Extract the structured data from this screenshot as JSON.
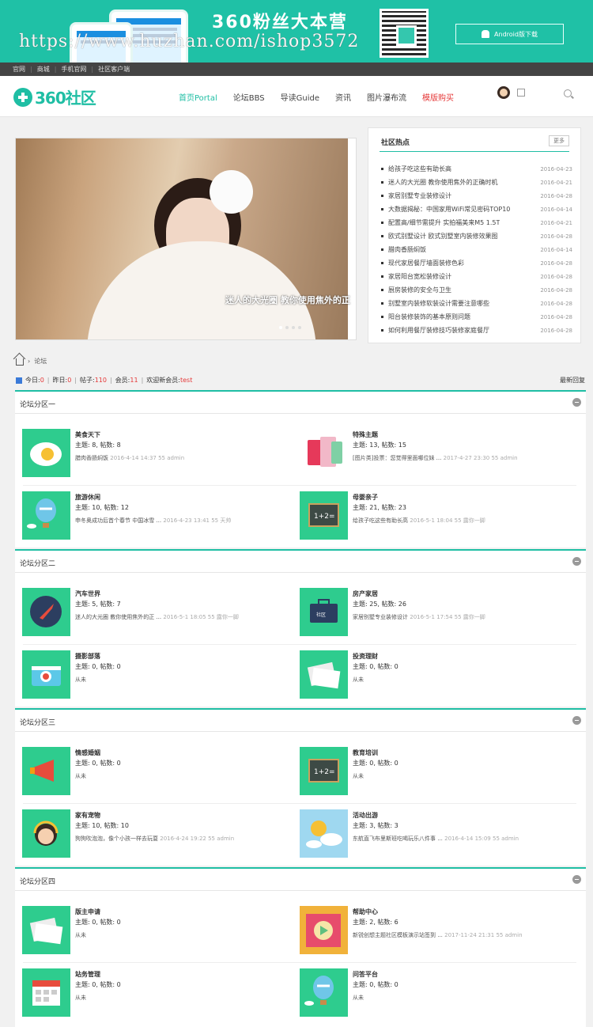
{
  "banner": {
    "title": "360粉丝大本营",
    "download": "Android版下载",
    "watermark": "https://www.huzhan.com/ishop3572",
    "phone_label": "360社区"
  },
  "topbar": {
    "links": [
      "官网",
      "商城",
      "手机官网",
      "社区客户端"
    ]
  },
  "header": {
    "logo": "360社区",
    "nav": [
      "首页Portal",
      "论坛BBS",
      "导读Guide",
      "资讯",
      "图片瀑布流",
      "模版购买"
    ]
  },
  "slider": {
    "caption": "迷人的大光圈 教你使用焦外的正"
  },
  "hot": {
    "title": "社区热点",
    "more": "更多",
    "items": [
      {
        "t": "给孩子吃这些有助长高",
        "d": "2016-04-23"
      },
      {
        "t": "迷人的大光圈 教你使用焦外的正确时机",
        "d": "2016-04-21"
      },
      {
        "t": "家居别墅专业装修设计",
        "d": "2016-04-28"
      },
      {
        "t": "大数据揭秘：中国家用WiFi常见密码TOP10",
        "d": "2016-04-14"
      },
      {
        "t": "配置高/细节需提升 实拍福美来M5 1.5T",
        "d": "2016-04-21"
      },
      {
        "t": "欧式别墅设计 欧式别墅室内装修效果图",
        "d": "2016-04-28"
      },
      {
        "t": "腊肉香肠焖饭",
        "d": "2016-04-14"
      },
      {
        "t": "现代家居餐厅墙面装修色彩",
        "d": "2016-04-28"
      },
      {
        "t": "家居阳台宽松装修设计",
        "d": "2016-04-28"
      },
      {
        "t": "厨房装修的安全与卫生",
        "d": "2016-04-28"
      },
      {
        "t": "别墅室内装修软装设计需要注意哪些",
        "d": "2016-04-28"
      },
      {
        "t": "阳台装修装饰的基本原则问题",
        "d": "2016-04-28"
      },
      {
        "t": "如何利用餐厅装修技巧装修家庭餐厅",
        "d": "2016-04-28"
      }
    ]
  },
  "crumb": {
    "label": "论坛"
  },
  "stats": {
    "today_l": "今日:",
    "today": "0",
    "yest_l": "昨日:",
    "yest": "0",
    "posts_l": "帖子:",
    "posts": "110",
    "members_l": "会员:",
    "members": "11",
    "welcome_l": "欢迎新会员:",
    "welcome": "test",
    "latest": "最新回复"
  },
  "sections": [
    {
      "title": "论坛分区一",
      "forums": [
        {
          "name": "美食天下",
          "count": "主题: 8, 帖数: 8",
          "last": "腊肉香肠焖饭",
          "meta": "2016-4-14 14:37 55 admin",
          "icon": "egg-icon"
        },
        {
          "name": "特殊主题",
          "count": "主题: 13, 帖数: 15",
          "last": "[图片类]投票：您觉得里面哪位妹 ...",
          "meta": "2017-4-27 23:30 55 admin",
          "icon": "phones-icon"
        },
        {
          "name": "旅游休闲",
          "count": "主题: 10, 帖数: 12",
          "last": "申冬奥成功后首个春节 中国冰雪 ...",
          "meta": "2016-4-23 13:41 55 天帅",
          "icon": "balloon-icon"
        },
        {
          "name": "母婴亲子",
          "count": "主题: 21, 帖数: 23",
          "last": "给孩子吃这些有助长高",
          "meta": "2016-5-1 18:04 55 露你一脚",
          "icon": "blackboard-icon"
        }
      ]
    },
    {
      "title": "论坛分区二",
      "forums": [
        {
          "name": "汽车世界",
          "count": "主题: 5, 帖数: 7",
          "last": "迷人的大光圈 教你使用焦外的正 ...",
          "meta": "2016-5-1 18:05 55 露你一脚",
          "icon": "rocket-icon"
        },
        {
          "name": "房产家居",
          "count": "主题: 25, 帖数: 26",
          "last": "家居别墅专业装修设计",
          "meta": "2016-5-1 17:54 55 露你一脚",
          "icon": "briefcase-icon"
        },
        {
          "name": "摄影部落",
          "count": "主题: 0, 帖数: 0",
          "last": "从未",
          "meta": "",
          "icon": "camera-icon"
        },
        {
          "name": "投资理财",
          "count": "主题: 0, 帖数: 0",
          "last": "从未",
          "meta": "",
          "icon": "newspaper-icon"
        }
      ]
    },
    {
      "title": "论坛分区三",
      "forums": [
        {
          "name": "情感婚姻",
          "count": "主题: 0, 帖数: 0",
          "last": "从未",
          "meta": "",
          "icon": "megaphone-icon"
        },
        {
          "name": "教育培训",
          "count": "主题: 0, 帖数: 0",
          "last": "从未",
          "meta": "",
          "icon": "blackboard-icon"
        },
        {
          "name": "家有宠物",
          "count": "主题: 10, 帖数: 10",
          "last": "狗狗吹泡泡，像个小孩一样去玩耍",
          "meta": "2016-4-24 19:22 55 admin",
          "icon": "headset-girl-icon"
        },
        {
          "name": "活动出游",
          "count": "主题: 3, 帖数: 3",
          "last": "东航直飞布里斯班吃喝玩乐八件事 ...",
          "meta": "2016-4-14 15:09 55 admin",
          "icon": "weather-icon"
        }
      ]
    },
    {
      "title": "论坛分区四",
      "forums": [
        {
          "name": "版主申请",
          "count": "主题: 0, 帖数: 0",
          "last": "从未",
          "meta": "",
          "icon": "newspaper-icon"
        },
        {
          "name": "帮助中心",
          "count": "主题: 2, 帖数: 6",
          "last": "新锐创想主题社区模板演示站签到 ...",
          "meta": "2017-11-24 21:31 55 admin",
          "icon": "video-icon"
        },
        {
          "name": "站务管理",
          "count": "主题: 0, 帖数: 0",
          "last": "从未",
          "meta": "",
          "icon": "calendar-icon"
        },
        {
          "name": "问答平台",
          "count": "主题: 0, 帖数: 0",
          "last": "从未",
          "meta": "",
          "icon": "balloon-icon"
        }
      ]
    }
  ]
}
